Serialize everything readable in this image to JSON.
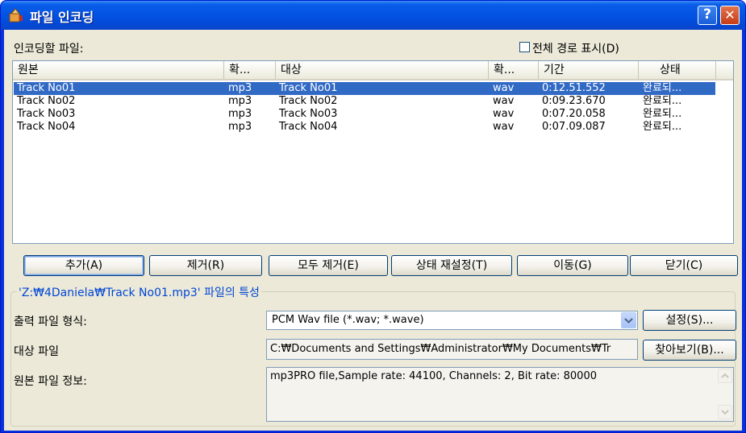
{
  "window": {
    "title": "파일 인코딩"
  },
  "files_label": "인코딩할 파일:",
  "show_full_path": {
    "label": "전체 경로 표시(D)",
    "checked": false
  },
  "list": {
    "columns": [
      "원본",
      "확...",
      "대상",
      "확...",
      "기간",
      "상태"
    ],
    "rows": [
      {
        "source": "Track No01",
        "src_ext": "mp3",
        "target": "Track No01",
        "tgt_ext": "wav",
        "duration": "0:12.51.552",
        "status": "완료되...",
        "selected": true
      },
      {
        "source": "Track No02",
        "src_ext": "mp3",
        "target": "Track No02",
        "tgt_ext": "wav",
        "duration": "0:09.23.670",
        "status": "완료되...",
        "selected": false
      },
      {
        "source": "Track No03",
        "src_ext": "mp3",
        "target": "Track No03",
        "tgt_ext": "wav",
        "duration": "0:07.20.058",
        "status": "완료되...",
        "selected": false
      },
      {
        "source": "Track No04",
        "src_ext": "mp3",
        "target": "Track No04",
        "tgt_ext": "wav",
        "duration": "0:07.09.087",
        "status": "완료되...",
        "selected": false
      }
    ]
  },
  "buttons": {
    "add": "추가(A)",
    "remove": "제거(R)",
    "remove_all": "모두 제거(E)",
    "reset_status": "상태 재설정(T)",
    "move": "이동(G)",
    "close": "닫기(C)"
  },
  "properties": {
    "group_title": "'Z:₩4Daniela₩Track No01.mp3' 파일의 특성",
    "output_format_label": "출력 파일 형식:",
    "output_format_value": "PCM Wav file (*.wav; *.wave)",
    "settings_button": "설정(S)...",
    "target_file_label": "대상 파일",
    "target_file_value": "C:₩Documents and Settings₩Administrator₩My Documents₩Tr",
    "browse_button": "찾아보기(B)...",
    "source_info_label": "원본 파일 정보:",
    "source_info_value": "mp3PRO file,Sample rate: 44100, Channels: 2, Bit rate: 80000"
  },
  "colors": {
    "titlebar": "#0353e3",
    "selection": "#316ac5",
    "dialog_bg": "#ece9d8",
    "group_title": "#0046d5"
  },
  "icons": [
    "app-icon",
    "help-icon",
    "close-icon",
    "dropdown-arrow-icon",
    "scroll-up-icon",
    "scroll-down-icon"
  ]
}
